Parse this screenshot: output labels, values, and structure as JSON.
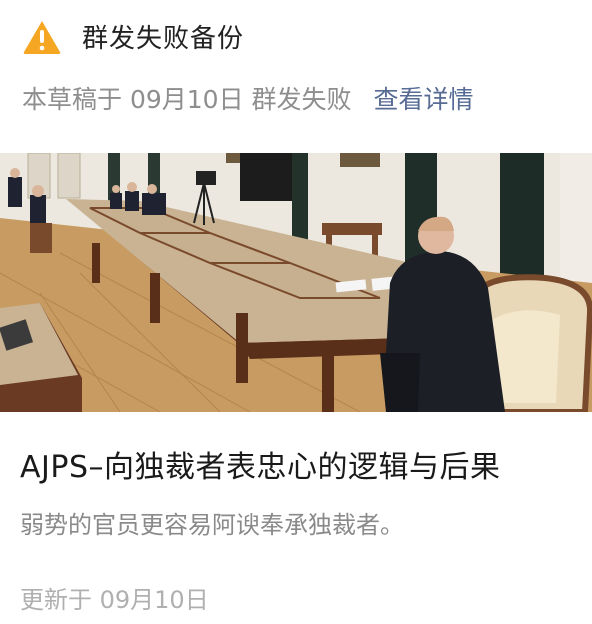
{
  "alert": {
    "icon": "warning-icon",
    "icon_color": "#f5a623",
    "title": "群发失败备份"
  },
  "meta": {
    "draft_text": "本草稿于 09月10日 群发失败",
    "view_link": "查看详情",
    "link_color": "#576b95"
  },
  "hero_image": {
    "description_icon": "meeting-photo"
  },
  "article": {
    "title": "AJPS–向独裁者表忠心的逻辑与后果",
    "description": "弱势的官员更容易阿谀奉承独裁者。",
    "updated": "更新于 09月10日"
  }
}
